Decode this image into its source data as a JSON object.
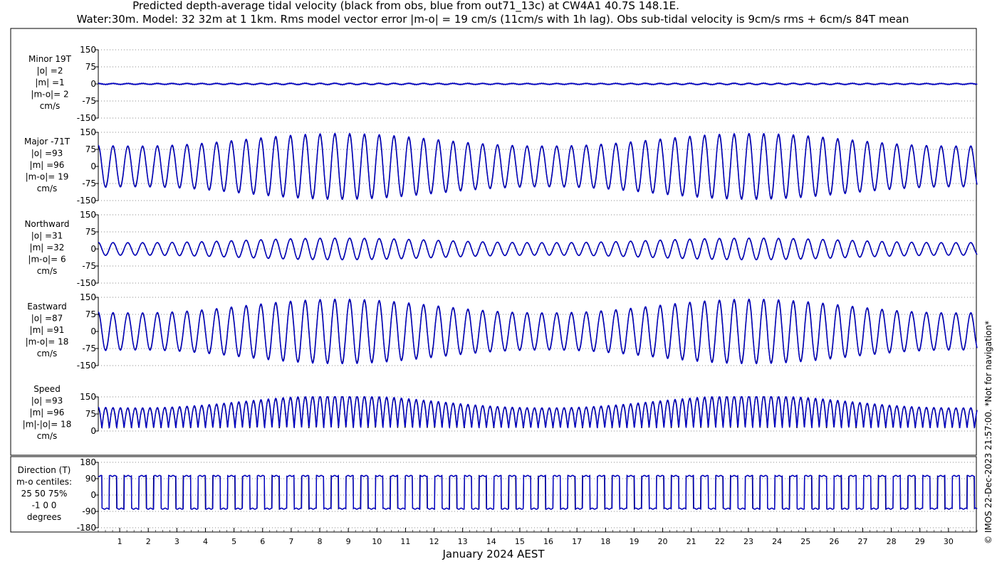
{
  "header": {
    "title_line1": "Predicted depth-average tidal velocity (black from obs, blue from out71_13c) at CW4A1 40.7S 148.1E.",
    "title_line2": "Water:30m. Model: 32 32m at 1 1km. Rms model vector error |m-o| = 19 cm/s (11cm/s with 1h lag). Obs sub-tidal velocity is 9cm/s rms + 6cm/s 84T mean"
  },
  "side_note": "© IMOS 22-Dec-2023 21:57:00. *Not for navigation*",
  "colors": {
    "obs": "#000000",
    "model": "#0000cc",
    "grid": "#666666"
  },
  "chart_data": {
    "type": "line",
    "xlabel": "January 2024 AEST",
    "x_ticks": [
      "1",
      "2",
      "3",
      "4",
      "5",
      "6",
      "7",
      "8",
      "9",
      "10",
      "11",
      "12",
      "13",
      "14",
      "15",
      "16",
      "17",
      "18",
      "19",
      "20",
      "21",
      "22",
      "23",
      "24",
      "25",
      "26",
      "27",
      "28",
      "29",
      "30"
    ],
    "x_range_days": [
      0.25,
      31.0
    ],
    "grid": "dotted horizontal",
    "series": [
      {
        "name": "obs"
      },
      {
        "name": "model"
      }
    ],
    "panels": [
      {
        "id": "minor",
        "labels": [
          "Minor 19T",
          "|o| =2",
          "|m| =1",
          "|m-o|= 2",
          "cm/s"
        ],
        "ylim": [
          -150,
          150
        ],
        "yticks": [
          "150",
          "75",
          "0",
          "-75",
          "-150"
        ],
        "kind": "oscillation",
        "amp_min": 2,
        "amp_max": 3,
        "offset": 0
      },
      {
        "id": "major",
        "labels": [
          "Major -71T",
          "|o| =93",
          "|m| =96",
          "|m-o|= 19",
          "cm/s"
        ],
        "ylim": [
          -150,
          150
        ],
        "yticks": [
          "150",
          "75",
          "0",
          "-75",
          "-150"
        ],
        "kind": "oscillation",
        "amp_min": 90,
        "amp_max": 145,
        "offset": 0
      },
      {
        "id": "northward",
        "labels": [
          "Northward",
          "|o| =31",
          "|m| =32",
          "|m-o|= 6",
          "cm/s"
        ],
        "ylim": [
          -150,
          150
        ],
        "yticks": [
          "150",
          "75",
          "0",
          "-75",
          "-150"
        ],
        "kind": "oscillation",
        "amp_min": 28,
        "amp_max": 48,
        "offset": 0
      },
      {
        "id": "eastward",
        "labels": [
          "Eastward",
          "|o| =87",
          "|m| =91",
          "|m-o|= 18",
          "cm/s"
        ],
        "ylim": [
          -150,
          150
        ],
        "yticks": [
          "150",
          "75",
          "0",
          "-75",
          "-150"
        ],
        "kind": "oscillation",
        "amp_min": 82,
        "amp_max": 142,
        "offset": 0
      },
      {
        "id": "speed",
        "labels": [
          "Speed",
          "|o| =93",
          "|m| =96",
          "|m|-|o|= 18",
          "cm/s"
        ],
        "ylim": [
          0,
          150
        ],
        "yticks": [
          "150",
          "75",
          "0"
        ],
        "kind": "speed",
        "amp_min": 90,
        "amp_max": 145,
        "offset": 0
      },
      {
        "id": "direction",
        "labels": [
          "Direction (T)",
          "m-o centiles:",
          "25  50  75%",
          "-1  0  0",
          "degrees"
        ],
        "ylim": [
          -180,
          180
        ],
        "yticks": [
          "180",
          "90",
          "0",
          "-90",
          "-180"
        ],
        "kind": "direction",
        "upper": 105,
        "lower": -75
      }
    ]
  }
}
